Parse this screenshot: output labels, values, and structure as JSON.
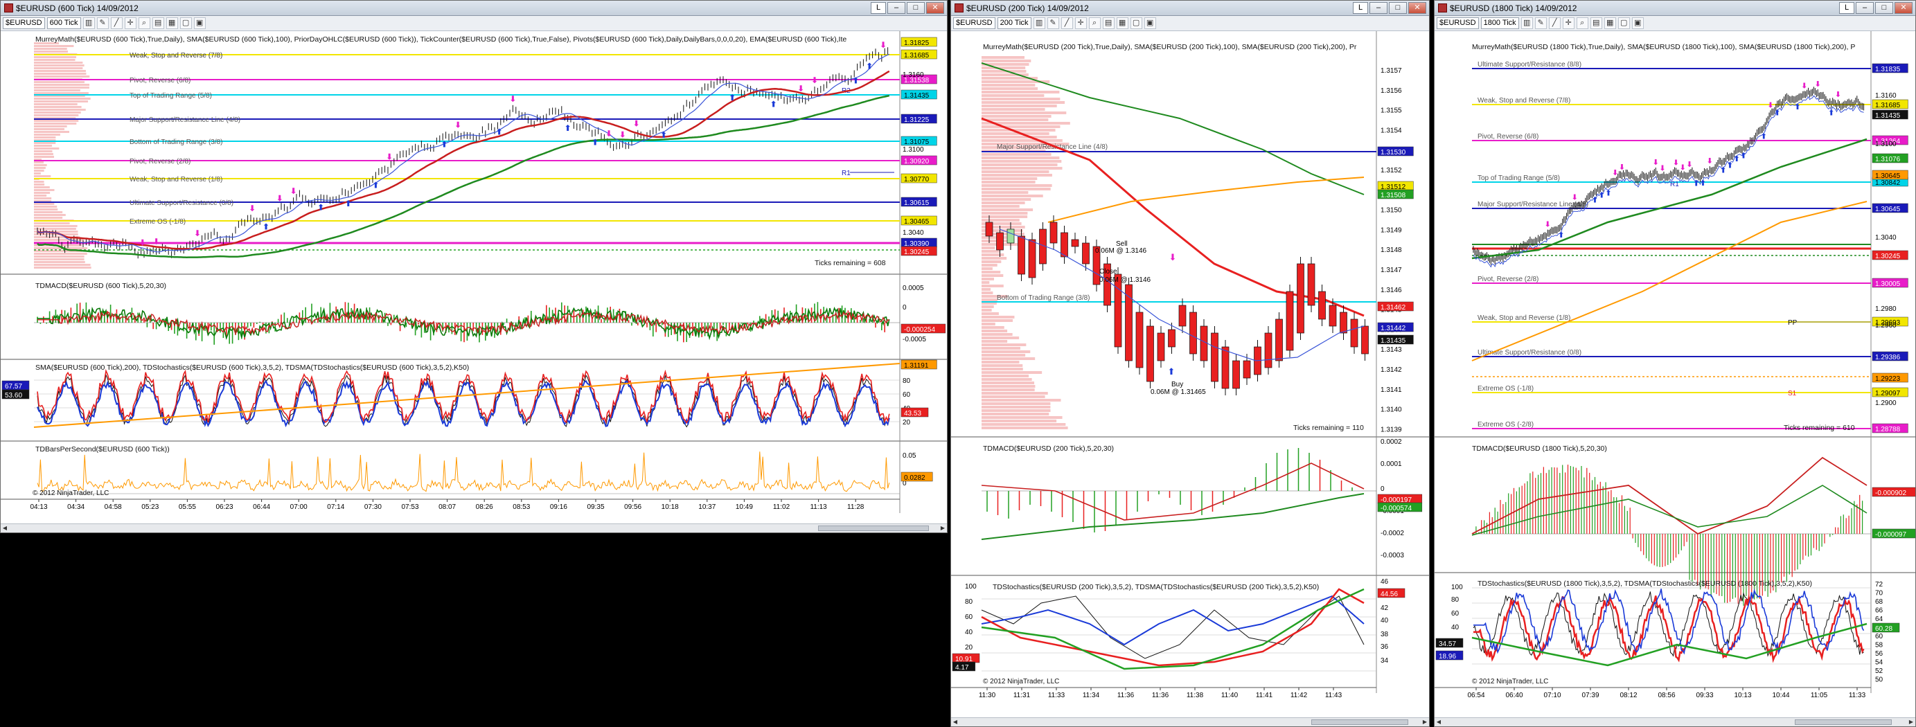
{
  "w1": {
    "title": "$EURUSD (600 Tick)  14/09/2012",
    "instrument": "$EURUSD",
    "period": "600 Tick",
    "main_ind": "MurreyMath($EURUSD (600 Tick),True,Daily), SMA($EURUSD (600 Tick),100), PriorDayOHLC($EURUSD (600 Tick)), TickCounter($EURUSD (600 Tick),True,False), Pivots($EURUSD (600 Tick),Daily,DailyBars,0,0,0,20), EMA($EURUSD (600 Tick),Ite",
    "mm_lines": [
      {
        "label": "Weak, Stop and Reverse (7/8)",
        "price": "1.31685",
        "color": "#f2e600"
      },
      {
        "label": "Pivot, Reverse (6/8)",
        "price": "1.31538",
        "color": "#e81cc9"
      },
      {
        "label": "Top of Trading Range (5/8)",
        "price": "1.31435",
        "color": "#00d4e8"
      },
      {
        "label": "Major Support/Resistance Line (4/8)",
        "price": "1.31225",
        "color": "#1a1ab8"
      },
      {
        "label": "Bottom of Trading Range (3/8)",
        "price": "1.31075",
        "color": "#00d4e8"
      },
      {
        "label": "Pivot, Reverse (2/8)",
        "price": "1.30920",
        "color": "#e81cc9"
      },
      {
        "label": "Weak, Stop and Reverse (1/8)",
        "price": "1.30770",
        "color": "#f2e600"
      },
      {
        "label": "Ultimate Support/Resistance (0/8)",
        "price": "1.30615",
        "color": "#1a1ab8"
      },
      {
        "label": "Extreme OS (-1/8)",
        "price": "1.30465",
        "color": "#f2e600"
      }
    ],
    "extra_prices": [
      "1.31825",
      "1.30390",
      "1.30245"
    ],
    "price_ticks": [
      "1.3160",
      "1.3100",
      "1.3040"
    ],
    "pivot_labels": [
      "R2",
      "R1"
    ],
    "ticks_remaining": "Ticks remaining = 608",
    "macd_label": "TDMACD($EURUSD (600 Tick),5,20,30)",
    "macd_ticks": [
      "0.0005",
      "0",
      "-0.0005"
    ],
    "macd_value": "-0.000254",
    "stoch_label": "SMA($EURUSD (600 Tick),200), TDStochastics($EURUSD (600 Tick),3,5,2), TDSMA(TDStochastics($EURUSD (600 Tick),3,5,2),K50)",
    "stoch_ticks": [
      "80",
      "60",
      "40",
      "20"
    ],
    "stoch_values": [
      "1.31191",
      "43.53"
    ],
    "stoch_left": [
      "67.57",
      "53.60"
    ],
    "bps_label": "TDBarsPerSecond($EURUSD (600 Tick))",
    "bps_ticks": [
      "0.05",
      "0"
    ],
    "bps_value": "0.0282",
    "copyright": "© 2012 NinjaTrader, LLC",
    "time_ticks": [
      "04:13",
      "04:34",
      "04:58",
      "05:23",
      "05:55",
      "06:23",
      "06:44",
      "07:00",
      "07:14",
      "07:30",
      "07:53",
      "08:07",
      "08:26",
      "08:53",
      "09:16",
      "09:35",
      "09:56",
      "10:18",
      "10:37",
      "10:49",
      "11:02",
      "11:13",
      "11:28"
    ]
  },
  "w2": {
    "title": "$EURUSD (200 Tick)  14/09/2012",
    "instrument": "$EURUSD",
    "period": "200 Tick",
    "main_ind": "MurreyMath($EURUSD (200 Tick),True,Daily), SMA($EURUSD (200 Tick),100), SMA($EURUSD (200 Tick),200), Pr",
    "mm_lines": [
      {
        "label": "Major Support/Resistance Line (4/8)",
        "price": "1.31530",
        "color": "#1a1ab8"
      },
      {
        "label": "Bottom of Trading Range (3/8)",
        "price": "1.31460",
        "color": "#00d4e8"
      }
    ],
    "price_ticks": [
      "1.3157",
      "1.3156",
      "1.3155",
      "1.3154",
      "1.3153",
      "1.3152",
      "1.3151",
      "1.3150",
      "1.3149",
      "1.3148",
      "1.3147",
      "1.3146",
      "1.3145",
      "1.3144",
      "1.3143",
      "1.3142",
      "1.3141",
      "1.3140",
      "1.3139"
    ],
    "price_tags": [
      {
        "v": "1.31512",
        "c": "#f2e600"
      },
      {
        "v": "1.31508",
        "c": "#22a022"
      },
      {
        "v": "1.31462",
        "c": "#e82020"
      },
      {
        "v": "1.31442",
        "c": "#1a1ab8"
      },
      {
        "v": "1.31435",
        "c": "#111111"
      }
    ],
    "trades": [
      "Sell",
      "0.06M @ 1.3146",
      "Close",
      "0.06M @ 1.3146",
      "Buy",
      "0.06M @ 1.31465"
    ],
    "ticks_remaining": "Ticks remaining = 110",
    "macd_label": "TDMACD($EURUSD (200 Tick),5,20,30)",
    "macd_ticks": [
      "0.0002",
      "0.0001",
      "0",
      "-0.0001",
      "-0.0002",
      "-0.0003"
    ],
    "macd_values": [
      "-0.000197",
      "-0.000574"
    ],
    "stoch_label": "TDStochastics($EURUSD (200 Tick),3,5,2), TDSMA(TDStochastics($EURUSD (200 Tick),3,5,2),K50)",
    "stoch_ticks": [
      "46",
      "44",
      "42",
      "40",
      "38",
      "36",
      "34"
    ],
    "stoch_left_ticks": [
      "100",
      "80",
      "60",
      "40",
      "20"
    ],
    "stoch_values": [
      "44.56"
    ],
    "stoch_left": [
      "10.91",
      "4.17"
    ],
    "copyright": "© 2012 NinjaTrader, LLC",
    "time_ticks": [
      "11:30",
      "11:31",
      "11:33",
      "11:34",
      "11:36",
      "11:36",
      "11:38",
      "11:40",
      "11:41",
      "11:42",
      "11:43"
    ]
  },
  "w3": {
    "title": "$EURUSD (1800 Tick)  14/09/2012",
    "instrument": "$EURUSD",
    "period": "1800 Tick",
    "main_ind": "MurreyMath($EURUSD (1800 Tick),True,Daily), SMA($EURUSD (1800 Tick),100), SMA($EURUSD (1800 Tick),200), P",
    "mm_lines": [
      {
        "label": "Ultimate Support/Resistance (8/8)",
        "price": "1.31835",
        "color": "#1a1ab8"
      },
      {
        "label": "Weak, Stop and Reverse (7/8)",
        "price": "1.31685",
        "color": "#f2e600"
      },
      {
        "label": "Pivot, Reverse (6/8)",
        "price": "1.31264",
        "color": "#e81cc9"
      },
      {
        "label": "Top of Trading Range (5/8)",
        "price": "1.30842",
        "color": "#00d4e8"
      },
      {
        "label": "Major Support/Resistance Line (4/8)",
        "price": "1.30645",
        "color": "#1a1ab8"
      },
      {
        "label": "Pivot, Reverse (2/8)",
        "price": "1.30005",
        "color": "#e81cc9"
      },
      {
        "label": "Weak, Stop and Reverse (1/8)",
        "price": "1.29693",
        "color": "#f2e600"
      },
      {
        "label": "Ultimate Support/Resistance (0/8)",
        "price": "1.29386",
        "color": "#1a1ab8"
      },
      {
        "label": "Extreme OS (-1/8)",
        "price": "1.29097",
        "color": "#f2e600"
      },
      {
        "label": "Extreme OS (-2/8)",
        "price": "1.28788",
        "color": "#e81cc9"
      }
    ],
    "price_ticks": [
      "1.3160",
      "1.3100",
      "1.3040",
      "1.2980",
      "1.2960",
      "1.2900"
    ],
    "price_tags": [
      {
        "v": "1.31435",
        "c": "#111111"
      },
      {
        "v": "1.31076",
        "c": "#22a022"
      },
      {
        "v": "1.30645",
        "c": "#ff9900"
      },
      {
        "v": "1.30245",
        "c": "#e82020"
      },
      {
        "v": "1.29223",
        "c": "#ff9900"
      }
    ],
    "pivot_labels": [
      "R1",
      "PP",
      "S1"
    ],
    "ticks_remaining": "Ticks remaining = 610",
    "macd_label": "TDMACD($EURUSD (1800 Tick),5,20,30)",
    "macd_values": [
      "-0.000902",
      "-0.000097"
    ],
    "stoch_label": "TDStochastics($EURUSD (1800 Tick),3,5,2), TDSMA(TDStochastics($EURUSD (1800 Tick),3,5,2),K50)",
    "stoch_ticks": [
      "72",
      "70",
      "68",
      "66",
      "64",
      "62",
      "60",
      "58",
      "56",
      "54",
      "52",
      "50"
    ],
    "stoch_left_ticks": [
      "100",
      "80",
      "60",
      "40",
      "20",
      "0"
    ],
    "stoch_values": [
      "60.28"
    ],
    "stoch_left": [
      "34.57",
      "18.96"
    ],
    "copyright": "© 2012 NinjaTrader, LLC",
    "time_ticks": [
      "06:54",
      "06:40",
      "07:10",
      "07:39",
      "08:12",
      "08:56",
      "09:33",
      "10:13",
      "10:44",
      "11:05",
      "11:33"
    ]
  },
  "ui": {
    "link_btn": "L",
    "min": "–",
    "max": "□",
    "close": "✕"
  }
}
